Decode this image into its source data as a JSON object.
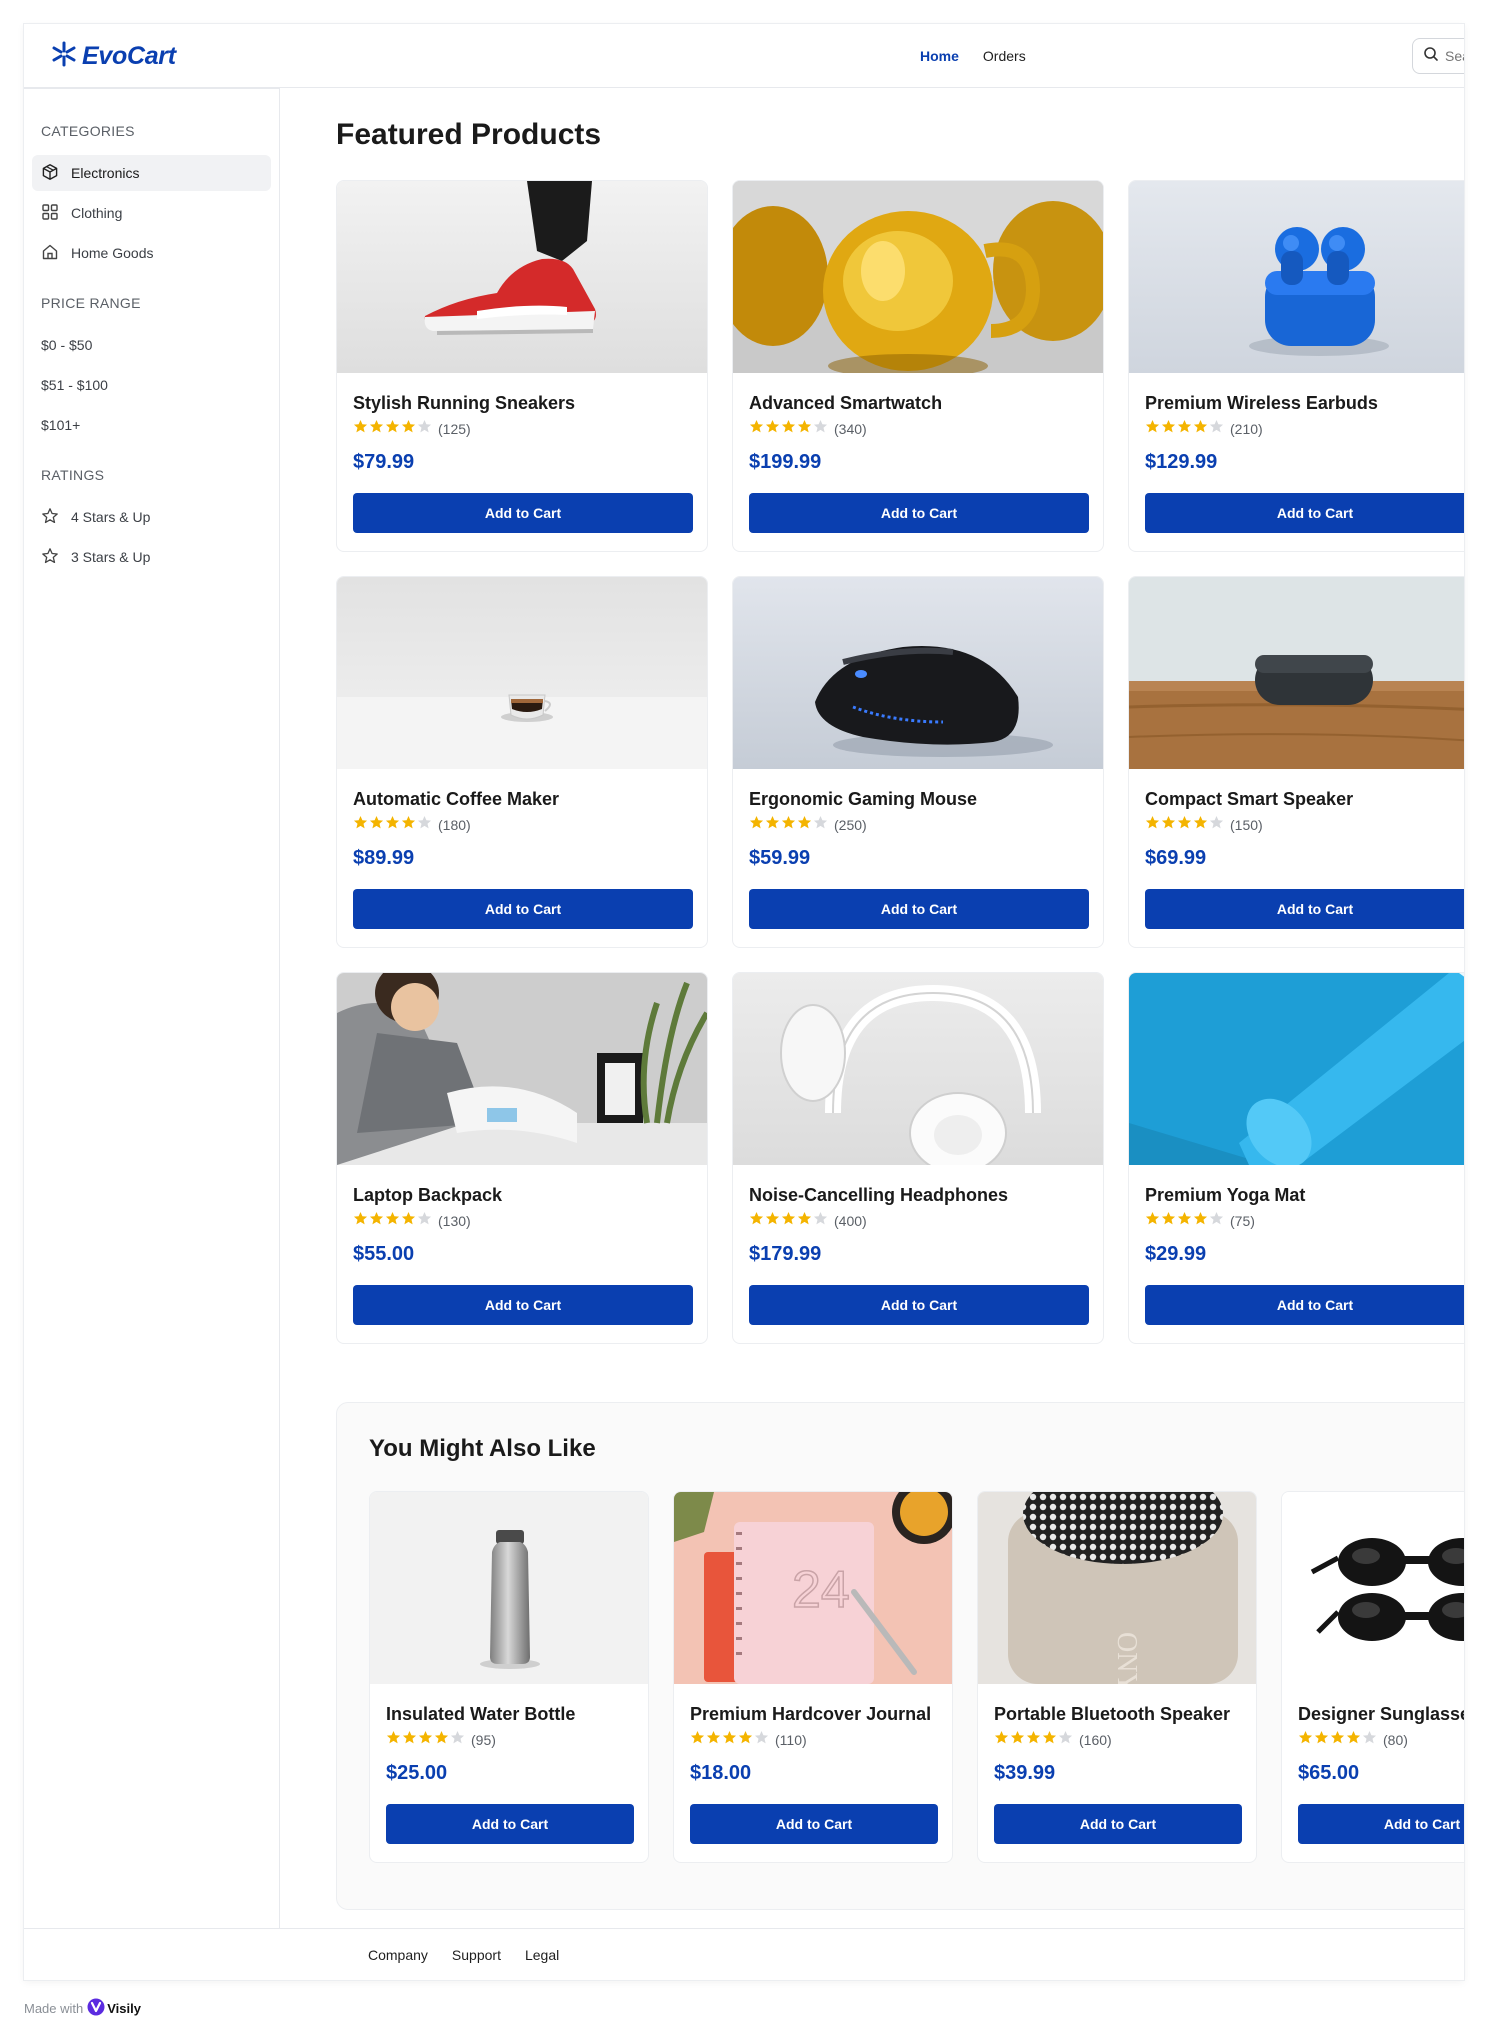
{
  "brand": {
    "name": "EvoCart",
    "color": "#0a3fb0"
  },
  "nav": {
    "home": "Home",
    "orders": "Orders"
  },
  "search": {
    "placeholder": "Search"
  },
  "sidebar": {
    "categories_heading": "CATEGORIES",
    "categories": [
      {
        "label": "Electronics",
        "icon": "box-icon",
        "selected": true
      },
      {
        "label": "Clothing",
        "icon": "grid-icon",
        "selected": false
      },
      {
        "label": "Home Goods",
        "icon": "home-icon",
        "selected": false
      }
    ],
    "price_heading": "PRICE RANGE",
    "prices": [
      "$0 - $50",
      "$51 - $100",
      "$101+"
    ],
    "ratings_heading": "RATINGS",
    "ratings": [
      "4 Stars & Up",
      "3 Stars & Up"
    ]
  },
  "main": {
    "title": "Featured Products",
    "add_to_cart_label": "Add to Cart",
    "products": [
      {
        "name": "Stylish Running Sneakers",
        "rating": 4,
        "reviews": "(125)",
        "price": "$79.99",
        "image": "sneaker"
      },
      {
        "name": "Advanced Smartwatch",
        "rating": 4,
        "reviews": "(340)",
        "price": "$199.99",
        "image": "glass"
      },
      {
        "name": "Premium Wireless Earbuds",
        "rating": 4,
        "reviews": "(210)",
        "price": "$129.99",
        "image": "earbuds"
      },
      {
        "name": "Automatic Coffee Maker",
        "rating": 4,
        "reviews": "(180)",
        "price": "$89.99",
        "image": "coffee"
      },
      {
        "name": "Ergonomic Gaming Mouse",
        "rating": 4,
        "reviews": "(250)",
        "price": "$59.99",
        "image": "mouse"
      },
      {
        "name": "Compact Smart Speaker",
        "rating": 4,
        "reviews": "(150)",
        "price": "$69.99",
        "image": "speaker"
      },
      {
        "name": "Laptop Backpack",
        "rating": 4,
        "reviews": "(130)",
        "price": "$55.00",
        "image": "reader"
      },
      {
        "name": "Noise-Cancelling Headphones",
        "rating": 4,
        "reviews": "(400)",
        "price": "$179.99",
        "image": "headphones"
      },
      {
        "name": "Premium Yoga Mat",
        "rating": 4,
        "reviews": "(75)",
        "price": "$29.99",
        "image": "yogamat"
      }
    ]
  },
  "recommendations": {
    "title": "You Might Also Like",
    "items": [
      {
        "name": "Insulated Water Bottle",
        "rating": 4,
        "reviews": "(95)",
        "price": "$25.00",
        "image": "bottle"
      },
      {
        "name": "Premium Hardcover Journal",
        "rating": 4,
        "reviews": "(110)",
        "price": "$18.00",
        "image": "journal",
        "image_text": "24"
      },
      {
        "name": "Portable Bluetooth Speaker",
        "rating": 4,
        "reviews": "(160)",
        "price": "$39.99",
        "image": "btspeaker",
        "image_text": "ONY"
      },
      {
        "name": "Designer Sunglasses",
        "rating": 4,
        "reviews": "(80)",
        "price": "$65.00",
        "image": "sunglasses"
      }
    ]
  },
  "footer": {
    "links": [
      "Company",
      "Support",
      "Legal"
    ]
  },
  "made_with": {
    "prefix": "Made with",
    "brand": "Visily"
  },
  "colors": {
    "accent": "#0a3fb0",
    "star": "#f4b400",
    "star_empty": "#d6d8dc"
  }
}
